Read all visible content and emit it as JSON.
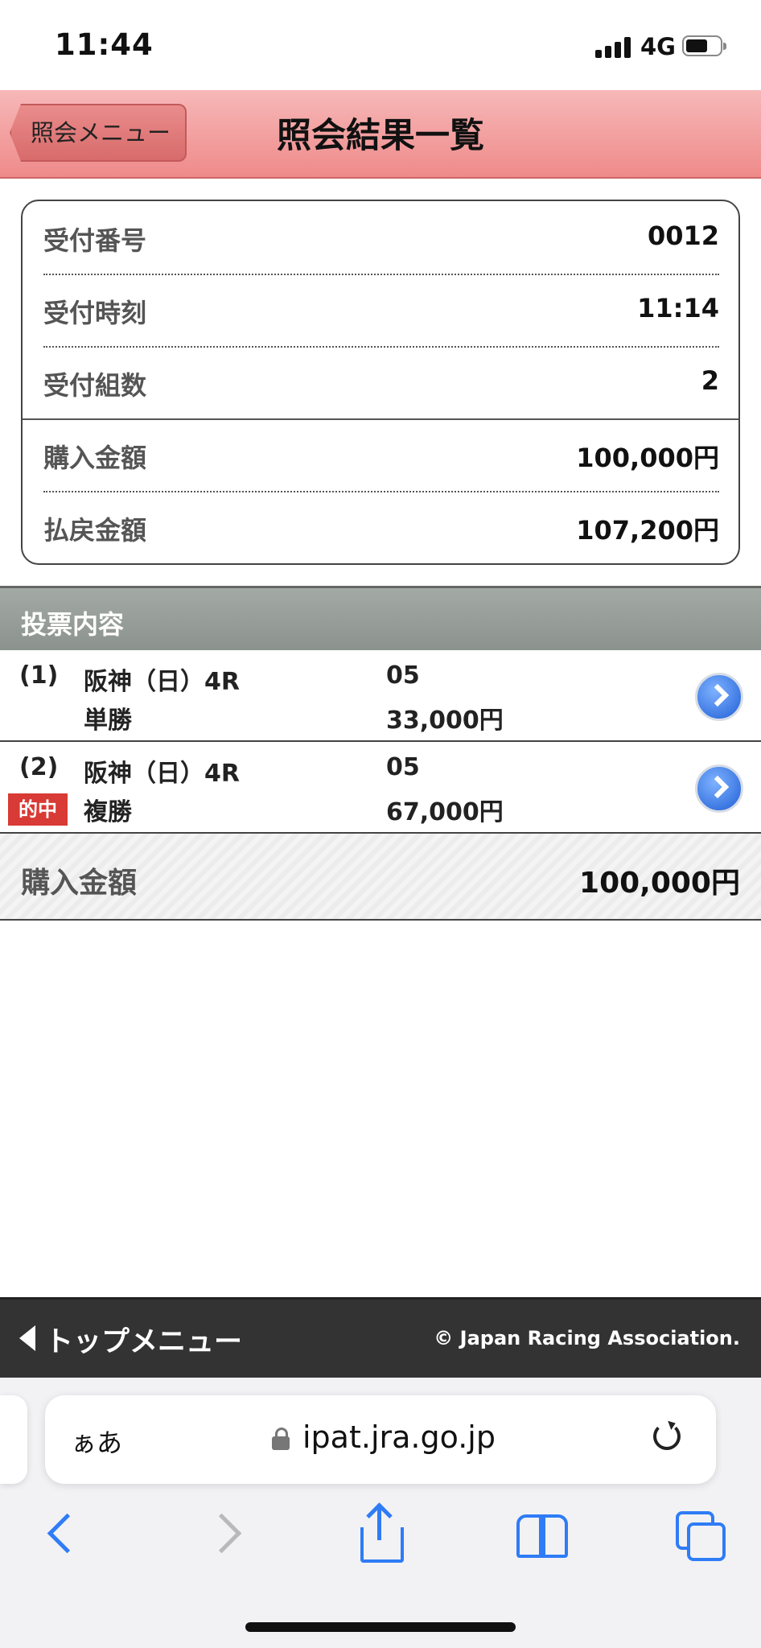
{
  "status_bar": {
    "time": "11:44",
    "network": "4G"
  },
  "header": {
    "back_label": "照会メニュー",
    "title": "照会結果一覧"
  },
  "summary": {
    "rows": [
      {
        "label": "受付番号",
        "value": "0012"
      },
      {
        "label": "受付時刻",
        "value": "11:14"
      },
      {
        "label": "受付組数",
        "value": "2"
      },
      {
        "label": "購入金額",
        "value": "100,000円"
      },
      {
        "label": "払戻金額",
        "value": "107,200円"
      }
    ]
  },
  "section": {
    "title": "投票内容"
  },
  "bets": [
    {
      "number": "(1)",
      "track": "阪神（日）4R",
      "type": "単勝",
      "horse": "05",
      "amount": "33,000円",
      "hit": ""
    },
    {
      "number": "(2)",
      "track": "阪神（日）4R",
      "type": "複勝",
      "horse": "05",
      "amount": "67,000円",
      "hit": "的中"
    }
  ],
  "total": {
    "label": "購入金額",
    "value": "100,000円"
  },
  "footer": {
    "top_menu": "トップメニュー",
    "copyright": "© Japan Racing Association."
  },
  "browser": {
    "aa": "ぁあ",
    "domain": "ipat.jra.go.jp"
  },
  "colors": {
    "header": "#ef8a8a",
    "section": "#8b928d",
    "hit_badge": "#d83a35",
    "accent": "#2f7cf6"
  }
}
